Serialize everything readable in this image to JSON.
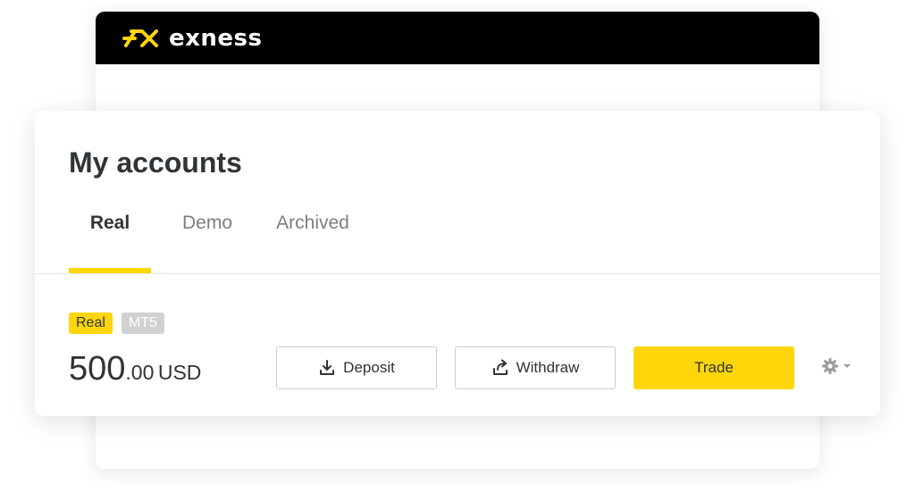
{
  "brand": {
    "name": "exness",
    "logo_color": "#ffd60a",
    "header_bg": "#000000"
  },
  "accounts": {
    "title": "My accounts",
    "tabs": [
      {
        "label": "Real",
        "active": true
      },
      {
        "label": "Demo",
        "active": false
      },
      {
        "label": "Archived",
        "active": false
      }
    ]
  },
  "account": {
    "badges": [
      "Real",
      "MT5"
    ],
    "balance_int": "500",
    "balance_dec": ".00",
    "currency": "USD",
    "actions": {
      "deposit": "Deposit",
      "withdraw": "Withdraw",
      "trade": "Trade"
    },
    "icons": {
      "deposit": "download-icon",
      "withdraw": "share-out-icon",
      "settings": "gear-icon",
      "settings_caret": "chevron-down-icon"
    }
  },
  "colors": {
    "accent": "#ffd60a",
    "text_primary": "#2f3438",
    "text_muted": "#7a7f84",
    "badge_grey": "#cfd1d3"
  }
}
